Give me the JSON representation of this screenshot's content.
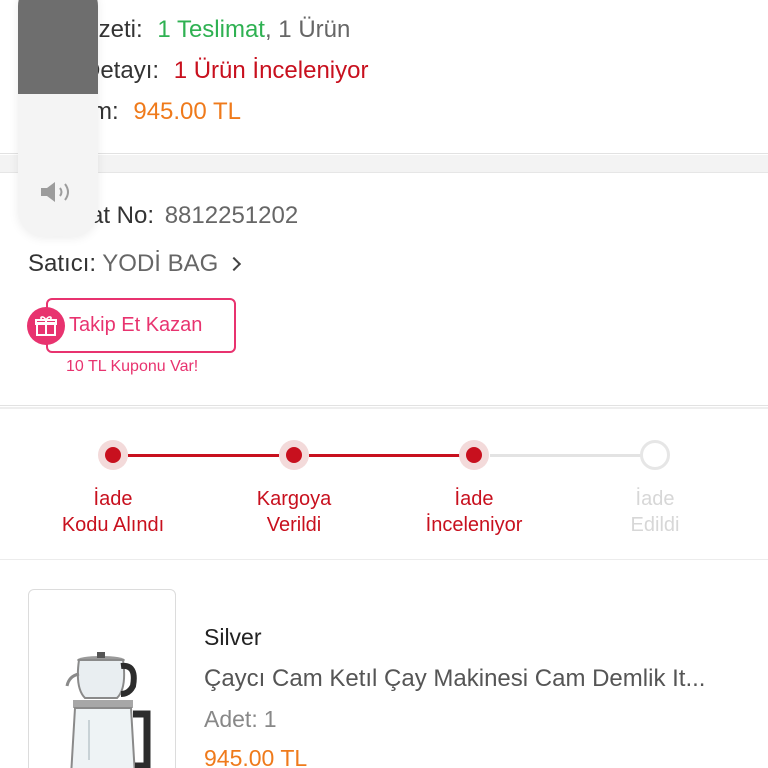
{
  "summary": {
    "ozet_label": "Özeti:",
    "ozet_value": "1 Teslimat",
    "ozet_suffix": ", 1 Ürün",
    "detay_label": "Detayı:",
    "detay_value": "1 Ürün İnceleniyor",
    "toplam_label": "m:",
    "toplam_value": "945.00 TL"
  },
  "shipment": {
    "no_label": "at No:",
    "no_value": "8812251202",
    "seller_label": "Satıcı:",
    "seller_value": "YODİ BAG",
    "follow_label": "Takip Et Kazan",
    "coupon_text": "10 TL Kuponu Var!"
  },
  "steps": [
    {
      "line1": "İade",
      "line2": "Kodu Alındı",
      "done": true
    },
    {
      "line1": "Kargoya",
      "line2": "Verildi",
      "done": true
    },
    {
      "line1": "İade",
      "line2": "İnceleniyor",
      "done": true
    },
    {
      "line1": "İade",
      "line2": "Edildi",
      "done": false
    }
  ],
  "product": {
    "brand": "Silver",
    "name": "Çaycı Cam Ketıl Çay Makinesi Cam Demlik It...",
    "qty_label": "Adet:",
    "qty_value": "1",
    "price": "945.00 TL"
  },
  "volume_hud": {
    "level": 0.45,
    "icon": "speaker-icon"
  },
  "colors": {
    "accent_red": "#c8101e",
    "success_green": "#2fb152",
    "price_orange": "#ef7a1b",
    "promo_pink": "#e8336f"
  }
}
